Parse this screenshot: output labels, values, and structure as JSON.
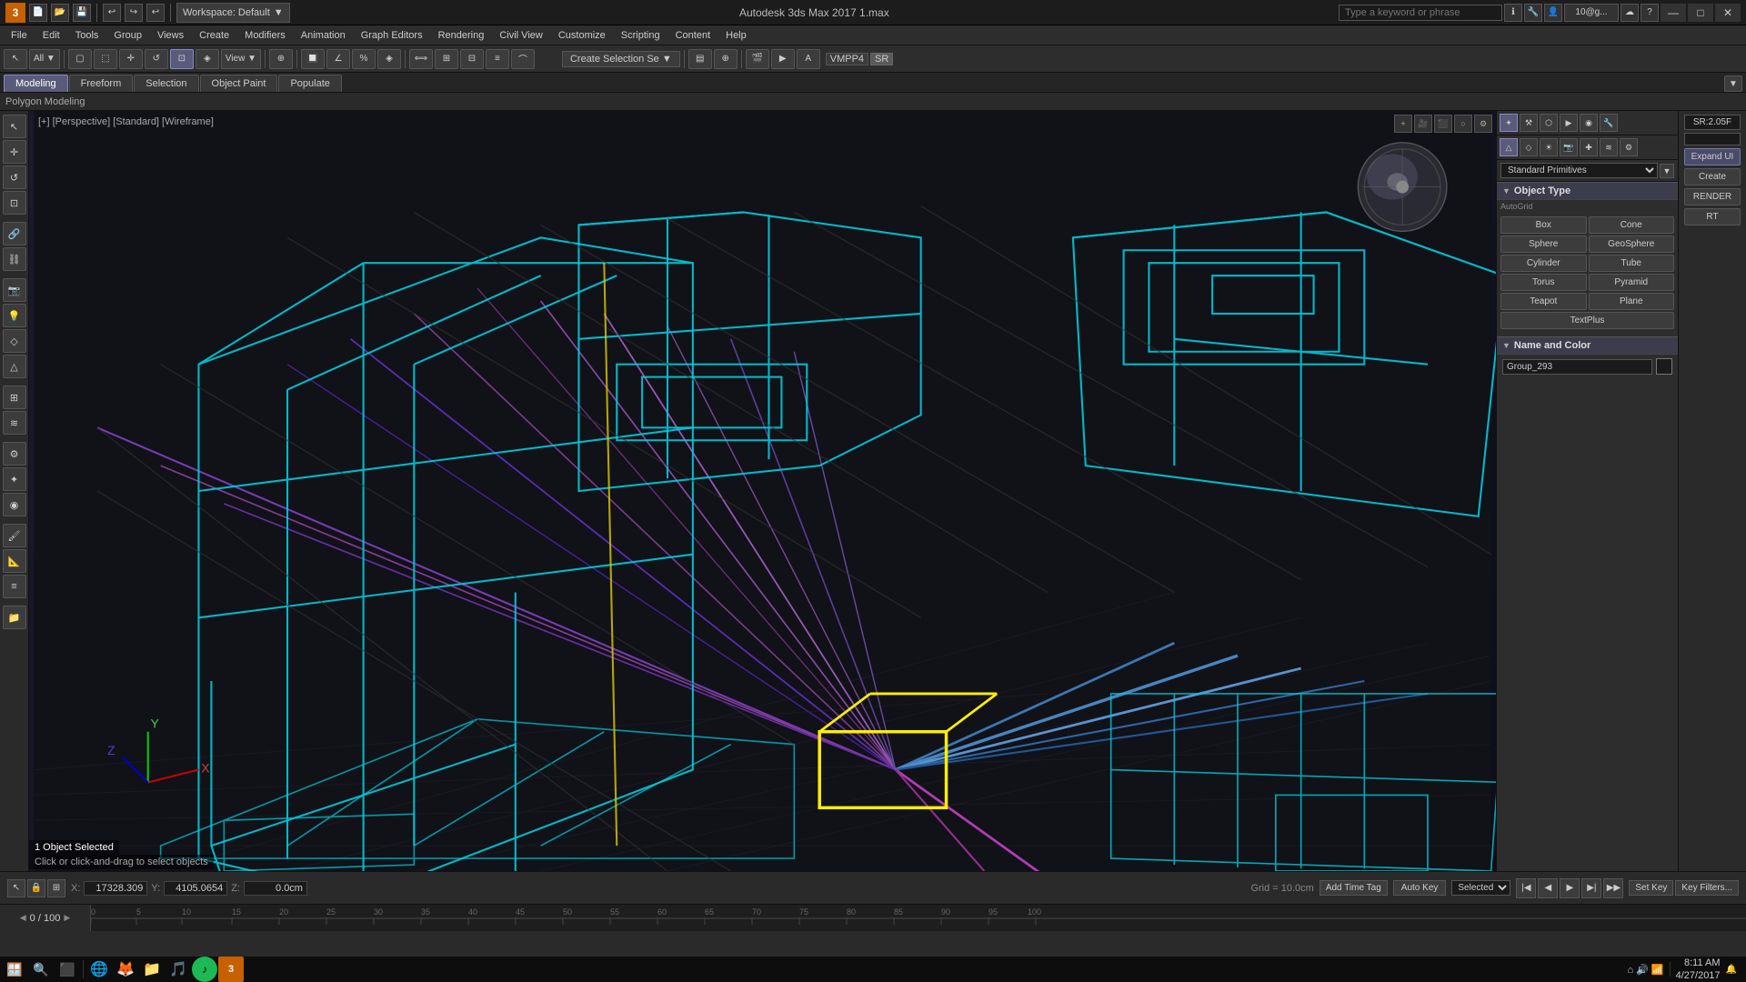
{
  "app": {
    "title": "Autodesk 3ds Max 2017  1.max",
    "workspace": "Workspace: Default"
  },
  "titlebar": {
    "app_icon": "3",
    "save_icon": "💾",
    "undo_icon": "↩",
    "redo_icon": "↪",
    "workspace_label": "Workspace: Default",
    "search_placeholder": "Type a keyword or phrase",
    "user": "10@g...",
    "minimize": "—",
    "maximize": "□",
    "close": "✕"
  },
  "menubar": {
    "items": [
      "File",
      "Edit",
      "Tools",
      "Group",
      "Views",
      "Create",
      "Modifiers",
      "Animation",
      "Graph Editors",
      "Rendering",
      "Civil View",
      "Customize",
      "Scripting",
      "Content",
      "Help"
    ]
  },
  "tabs": {
    "items": [
      "Modeling",
      "Freeform",
      "Selection",
      "Object Paint",
      "Populate"
    ],
    "active": "Modeling",
    "subtab": "Polygon Modeling"
  },
  "viewport": {
    "label": "[+] [Perspective] [Standard] [Wireframe]",
    "obj_selected": "1 Object Selected",
    "click_drag": "Click or click-and-drag to select objects"
  },
  "right_panel": {
    "dropdown_label": "Standard Primitives",
    "section_object_type": "Object Type",
    "autoroll": "AutoGrid",
    "primitives": [
      "Box",
      "Cone",
      "Sphere",
      "GeoSphere",
      "Cylinder",
      "Tube",
      "Torus",
      "Pyramid",
      "Teapot",
      "Plane",
      "TextPlus",
      ""
    ],
    "section_name_color": "Name and Color",
    "name_value": "Group_293",
    "expand_ui": "Expand UI",
    "create_btn": "Create",
    "render_btn": "RENDER",
    "rt_btn": "RT",
    "spinval": "SR: 2.05F"
  },
  "statusbar": {
    "x_label": "X:",
    "x_val": "17328.309",
    "y_label": "Y:",
    "y_val": "4105.0654",
    "z_label": "Z:",
    "z_val": "0.0cm",
    "grid_label": "Grid = 10.0cm",
    "add_time_tag": "Add Time Tag"
  },
  "anim_controls": {
    "auto_key": "Auto Key",
    "selected_label": "Selected",
    "set_key": "Set Key",
    "key_filters": "Key Filters...",
    "time": "0 / 100"
  },
  "timeline": {
    "markers": [
      "0",
      "5",
      "10",
      "15",
      "20",
      "25",
      "30",
      "35",
      "40",
      "45",
      "50",
      "55",
      "60",
      "65",
      "70",
      "75",
      "80",
      "85",
      "90",
      "95",
      "100"
    ]
  },
  "taskbar": {
    "date": "4/27/2017",
    "time": "8:11 AM",
    "icons": [
      "🪟",
      "🔍",
      "🗂",
      "🌐",
      "🦊",
      "📂",
      "🎵",
      "🎨",
      "🎯"
    ]
  }
}
